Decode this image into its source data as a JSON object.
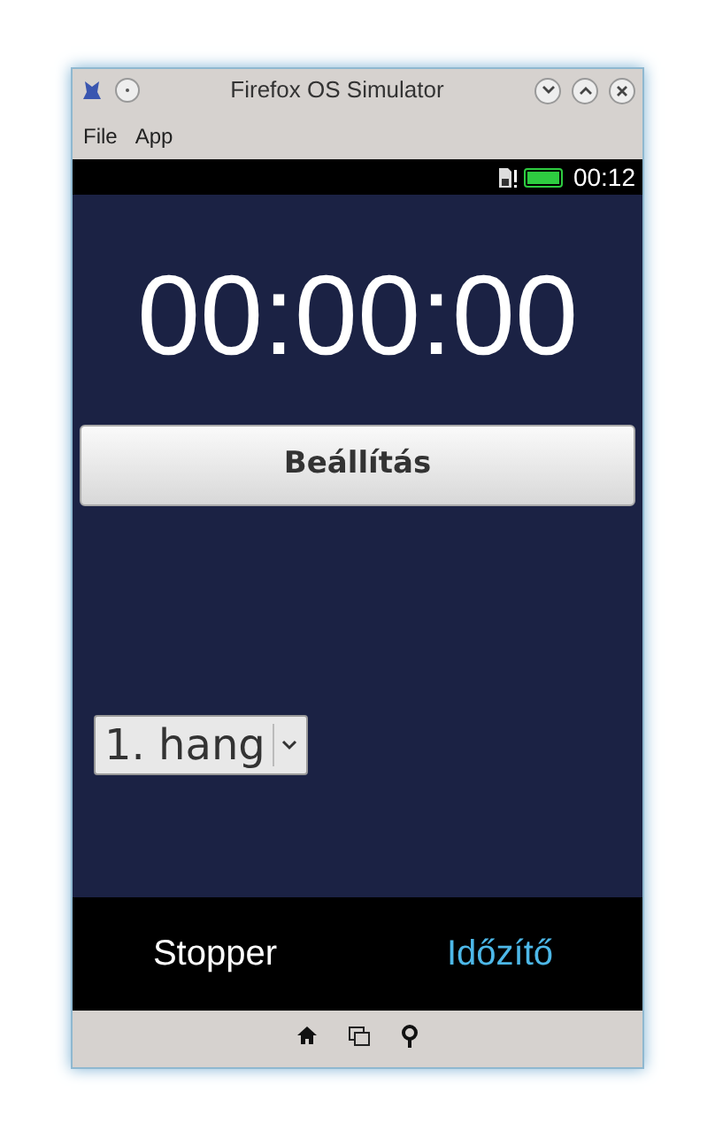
{
  "window": {
    "title": "Firefox OS Simulator"
  },
  "menu": [
    "File",
    "App"
  ],
  "status_bar": {
    "time": "00:12"
  },
  "timer": {
    "display": "00:00:00",
    "settings_button": "Beállítás",
    "sound_select": {
      "value": "1. hang"
    }
  },
  "tabs": [
    {
      "label": "Stopper",
      "selected": false
    },
    {
      "label": "Időzítő",
      "selected": true
    }
  ]
}
